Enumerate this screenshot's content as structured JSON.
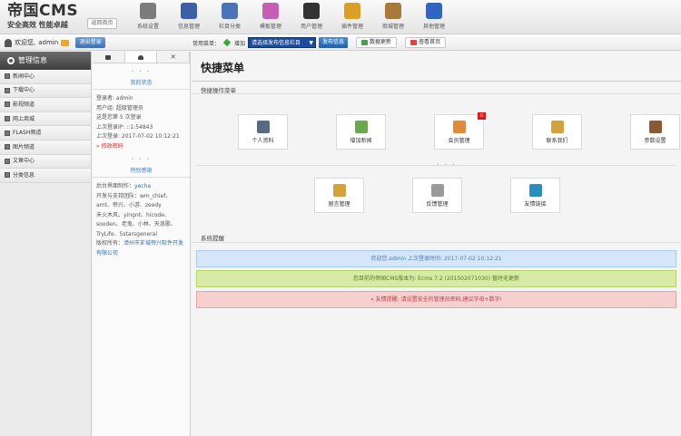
{
  "header": {
    "logo_title": "帝国CMS",
    "logo_slogan": "安全高效 性能卓越",
    "home_button": "返回首页",
    "nav": [
      {
        "label": "系统设置",
        "icon": "settings-icon",
        "color": "#7b7b7b"
      },
      {
        "label": "信息管理",
        "icon": "document-icon",
        "color": "#3c5fa8"
      },
      {
        "label": "栏目分类",
        "icon": "columns-icon",
        "color": "#4a74b8"
      },
      {
        "label": "模板管理",
        "icon": "palette-icon",
        "color": "#c45fb4"
      },
      {
        "label": "用户管理",
        "icon": "user-icon",
        "color": "#333333"
      },
      {
        "label": "插件管理",
        "icon": "plugin-icon",
        "color": "#d9a022"
      },
      {
        "label": "商城管理",
        "icon": "cart-icon",
        "color": "#a87a3a"
      },
      {
        "label": "其他管理",
        "icon": "play-icon",
        "color": "#2f66c4"
      }
    ]
  },
  "subbar": {
    "welcome": "欢迎您,",
    "username": "admin",
    "logout": "退出登录",
    "quick_label": "常用菜单：",
    "add_label": "增加",
    "column_select": "请选择发布信息栏目",
    "publish_button": "发布信息",
    "refresh_button": "数据更新",
    "view_home_button": "查看首页"
  },
  "sidebar": {
    "title": "管理信息",
    "items": [
      "新闻中心",
      "下载中心",
      "影视频道",
      "网上商城",
      "FLASH频道",
      "图片频道",
      "文章中心",
      "分类信息"
    ]
  },
  "mid": {
    "my_status_title": "我的状态",
    "login_name": "登录者: admin",
    "user_group": "用户组: 超级管理员",
    "login_count": "这是您第 5 次登录",
    "last_ip": "上次登录IP: ::1:54843",
    "last_time": "上次登录: 2017-07-02 10:12:21",
    "change_password": "» 修改密码",
    "credits_title": "特别感谢",
    "credits_lines": [
      "后台界面制作：",
      "开发与支持团队：wm_chief、",
      "amt、帝兴、小游、zeedy",
      "禾火木风、yingnt、hicode、",
      "sooden、老鬼、小林、天浪歌、",
      "TryLife、5starsgeneral",
      "版权所有："
    ],
    "designer": "yecha",
    "company": "漳州市芗城帝兴软件开发有限公司"
  },
  "main": {
    "title": "快捷菜单",
    "subtitle": "快捷操作菜单",
    "quick_items": [
      {
        "label": "个人资料",
        "icon": "profile-icon",
        "color": "#556a85"
      },
      {
        "label": "增加新闻",
        "icon": "add-news-icon",
        "color": "#6aa84f"
      },
      {
        "label": "会员管理",
        "icon": "members-icon",
        "color": "#e28a3a",
        "badge": "0"
      },
      {
        "label": "联系我们",
        "icon": "contact-icon",
        "color": "#d4a13a"
      },
      {
        "label": "参数设置",
        "icon": "tools-icon",
        "color": "#8a5a32"
      },
      {
        "label": "留言管理",
        "icon": "message-icon",
        "color": "#d4a13a"
      },
      {
        "label": "反馈管理",
        "icon": "feedback-icon",
        "color": "#9a9a9a"
      },
      {
        "label": "友情链接",
        "icon": "links-icon",
        "color": "#2a8fbf"
      }
    ],
    "system_title": "系统提醒",
    "notices": [
      "欢迎您,admin 上次登录时间: 2017-07-02 10:12:21",
      "您目前的帝国CMS版本为: Ecms 7.2 (201502071030) 暂时无更新",
      "» 友情提醒: 请设置安全的管理员密码,建议字母+数字!"
    ]
  }
}
